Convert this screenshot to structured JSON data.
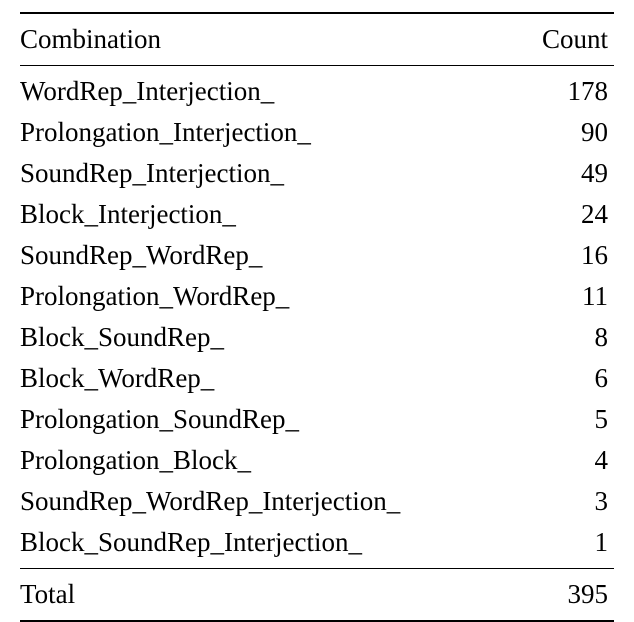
{
  "headers": {
    "combination": "Combination",
    "count": "Count"
  },
  "rows": [
    {
      "combination": "WordRep_Interjection_",
      "count": "178"
    },
    {
      "combination": "Prolongation_Interjection_",
      "count": "90"
    },
    {
      "combination": "SoundRep_Interjection_",
      "count": "49"
    },
    {
      "combination": "Block_Interjection_",
      "count": "24"
    },
    {
      "combination": "SoundRep_WordRep_",
      "count": "16"
    },
    {
      "combination": "Prolongation_WordRep_",
      "count": "11"
    },
    {
      "combination": "Block_SoundRep_",
      "count": "8"
    },
    {
      "combination": "Block_WordRep_",
      "count": "6"
    },
    {
      "combination": "Prolongation_SoundRep_",
      "count": "5"
    },
    {
      "combination": "Prolongation_Block_",
      "count": "4"
    },
    {
      "combination": "SoundRep_WordRep_Interjection_",
      "count": "3"
    },
    {
      "combination": "Block_SoundRep_Interjection_",
      "count": "1"
    }
  ],
  "total": {
    "label": "Total",
    "count": "395"
  },
  "chart_data": {
    "type": "table",
    "columns": [
      "Combination",
      "Count"
    ],
    "rows": [
      [
        "WordRep_Interjection_",
        178
      ],
      [
        "Prolongation_Interjection_",
        90
      ],
      [
        "SoundRep_Interjection_",
        49
      ],
      [
        "Block_Interjection_",
        24
      ],
      [
        "SoundRep_WordRep_",
        16
      ],
      [
        "Prolongation_WordRep_",
        11
      ],
      [
        "Block_SoundRep_",
        8
      ],
      [
        "Block_WordRep_",
        6
      ],
      [
        "Prolongation_SoundRep_",
        5
      ],
      [
        "Prolongation_Block_",
        4
      ],
      [
        "SoundRep_WordRep_Interjection_",
        3
      ],
      [
        "Block_SoundRep_Interjection_",
        1
      ]
    ],
    "total": 395
  }
}
